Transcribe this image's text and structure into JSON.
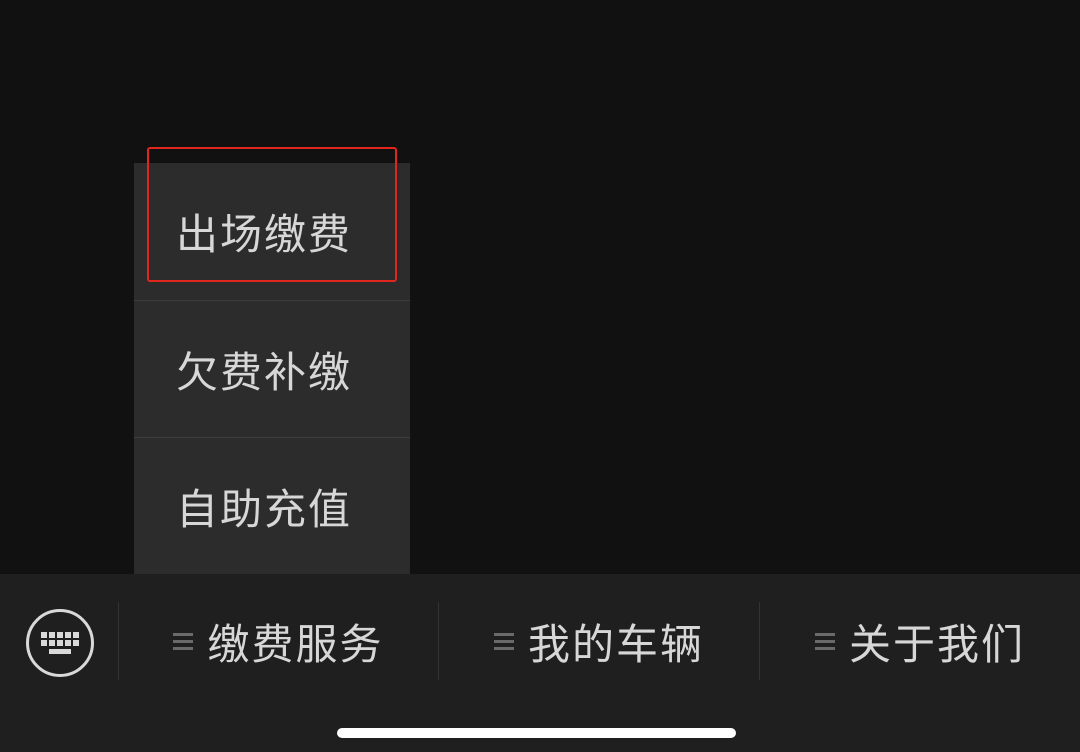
{
  "submenu": {
    "items": [
      {
        "label": "出场缴费"
      },
      {
        "label": "欠费补缴"
      },
      {
        "label": "自助充值"
      }
    ]
  },
  "menubar": {
    "keyboard_icon": "keyboard-icon",
    "tabs": [
      {
        "label": "缴费服务",
        "icon": "menu-lines-icon"
      },
      {
        "label": "我的车辆",
        "icon": "menu-lines-icon"
      },
      {
        "label": "关于我们",
        "icon": "menu-lines-icon"
      }
    ]
  },
  "colors": {
    "background": "#111111",
    "submenu_bg": "#2c2c2c",
    "menubar_bg": "#1f1f1f",
    "highlight": "#e0261d",
    "text": "#d7d7d7"
  }
}
